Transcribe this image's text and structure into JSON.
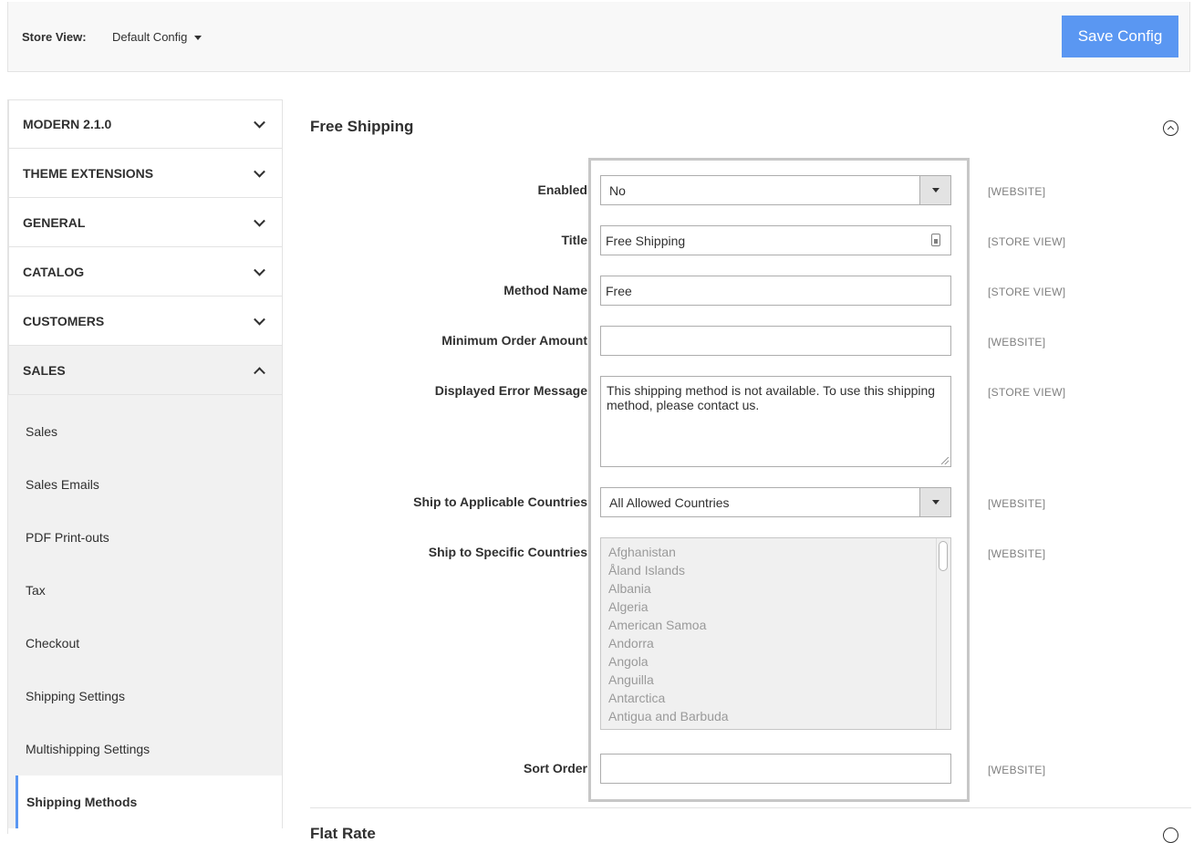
{
  "store": {
    "label": "Store View:",
    "selected": "Default Config",
    "save_label": "Save Config"
  },
  "sidebar": {
    "sections": [
      {
        "label": "MODERN 2.1.0",
        "open": false
      },
      {
        "label": "THEME EXTENSIONS",
        "open": false
      },
      {
        "label": "GENERAL",
        "open": false
      },
      {
        "label": "CATALOG",
        "open": false
      },
      {
        "label": "CUSTOMERS",
        "open": false
      },
      {
        "label": "SALES",
        "open": true
      }
    ],
    "sales_items": [
      "Sales",
      "Sales Emails",
      "PDF Print-outs",
      "Tax",
      "Checkout",
      "Shipping Settings",
      "Multishipping Settings",
      "Shipping Methods"
    ],
    "active_item": "Shipping Methods"
  },
  "main": {
    "section_title": "Free Shipping",
    "fields": {
      "enabled": {
        "label": "Enabled",
        "value": "No",
        "scope": "[WEBSITE]"
      },
      "title": {
        "label": "Title",
        "value": "Free Shipping",
        "scope": "[STORE VIEW]"
      },
      "method_name": {
        "label": "Method Name",
        "value": "Free",
        "scope": "[STORE VIEW]"
      },
      "min_order": {
        "label": "Minimum Order Amount",
        "value": "",
        "scope": "[WEBSITE]"
      },
      "error_message": {
        "label": "Displayed Error Message",
        "value": "This shipping method is not available. To use this shipping method, please contact us.",
        "scope": "[STORE VIEW]"
      },
      "applicable_countries": {
        "label": "Ship to Applicable Countries",
        "value": "All Allowed Countries",
        "scope": "[WEBSITE]"
      },
      "specific_countries": {
        "label": "Ship to Specific Countries",
        "scope": "[WEBSITE]",
        "options": [
          "Afghanistan",
          "Åland Islands",
          "Albania",
          "Algeria",
          "American Samoa",
          "Andorra",
          "Angola",
          "Anguilla",
          "Antarctica",
          "Antigua and Barbuda"
        ]
      },
      "sort_order": {
        "label": "Sort Order",
        "value": "",
        "scope": "[WEBSITE]"
      }
    },
    "next_section_title": "Flat Rate"
  }
}
